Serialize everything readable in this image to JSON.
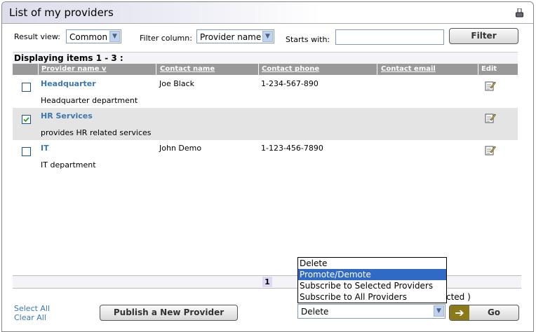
{
  "window": {
    "title": "List of my providers"
  },
  "filters": {
    "result_view_label": "Result view:",
    "result_view_value": "Common",
    "filter_column_label": "Filter column:",
    "filter_column_value": "Provider name",
    "starts_with_label": "Starts with:",
    "starts_with_value": "",
    "filter_button": "Filter"
  },
  "display_info": "Displaying items 1 - 3 :",
  "columns": [
    "Provider name",
    "Contact name",
    "Contact phone",
    "Contact email",
    "Edit"
  ],
  "sort_indicator": "v",
  "rows": [
    {
      "name": "Headquarter",
      "contact": "Joe Black",
      "phone": "1-234-567-890",
      "email": "",
      "description": "Headquarter department",
      "checked": false
    },
    {
      "name": "HR Services",
      "contact": "",
      "phone": "",
      "email": "",
      "description": "provides HR related services",
      "checked": true
    },
    {
      "name": "IT",
      "contact": "John Demo",
      "phone": "1-123-456-7890",
      "email": "",
      "description": "IT department",
      "checked": false
    }
  ],
  "pagination": {
    "current": "1"
  },
  "footer": {
    "select_all": "Select All",
    "clear_all": "Clear All",
    "publish_button": "Publish a New Provider",
    "selected_hint": "cted )",
    "action_value": "Delete",
    "go_button": "Go"
  },
  "action_options": [
    "Delete",
    "Promote/Demote",
    "Subscribe to Selected Providers",
    "Subscribe to All Providers"
  ],
  "highlighted_option": "Promote/Demote"
}
